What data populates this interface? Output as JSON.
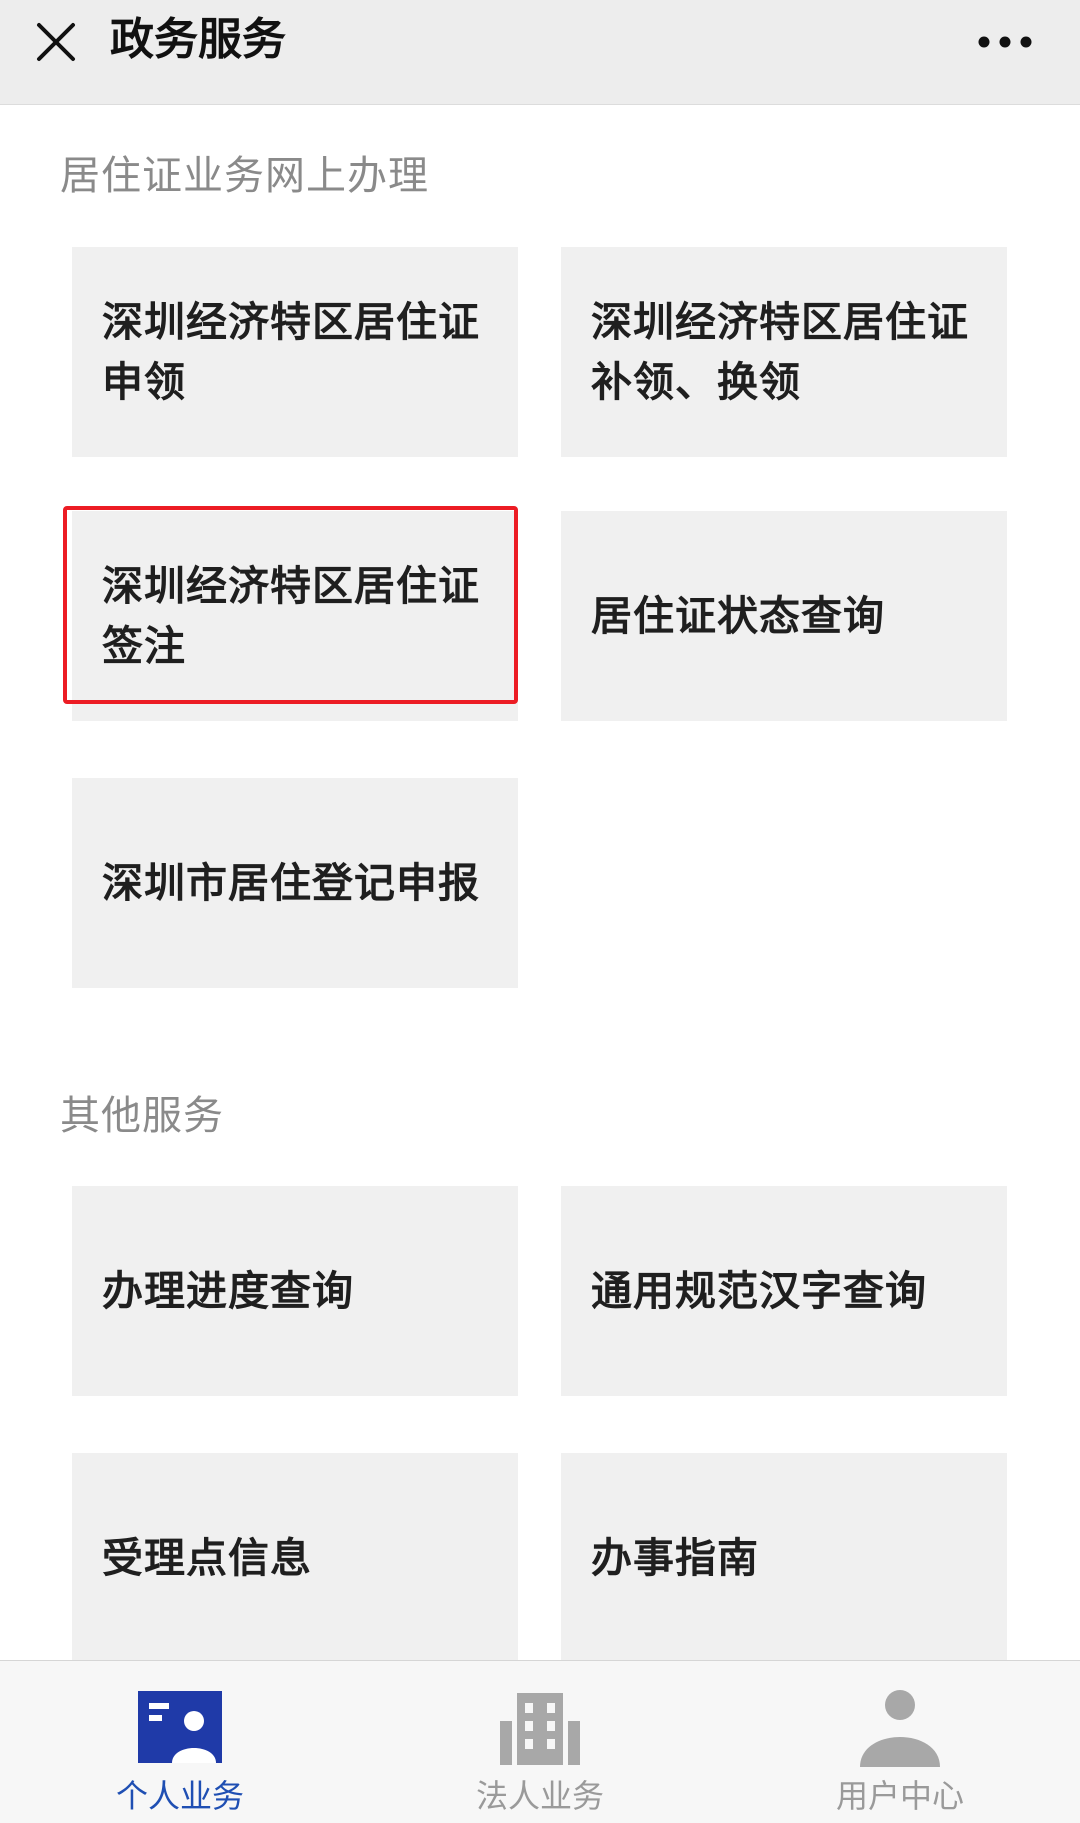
{
  "header": {
    "title": "政务服务",
    "close_icon": "close-icon",
    "more_icon": "more-dots-icon"
  },
  "sections": [
    {
      "title": "居住证业务网上办理",
      "items": [
        {
          "label": "深圳经济特区居住证申领"
        },
        {
          "label": "深圳经济特区居住证补领、换领"
        },
        {
          "label": "深圳经济特区居住证签注",
          "highlighted": true
        },
        {
          "label": "居住证状态查询"
        },
        {
          "label": "深圳市居住登记申报"
        }
      ]
    },
    {
      "title": "其他服务",
      "items": [
        {
          "label": "办理进度查询"
        },
        {
          "label": "通用规范汉字查询"
        },
        {
          "label": "受理点信息"
        },
        {
          "label": "办事指南"
        }
      ]
    }
  ],
  "highlight_color": "#ec1c24",
  "tabbar": {
    "active_index": 0,
    "active_color": "#1f4fb3",
    "inactive_color": "#9a9a9a",
    "tabs": [
      {
        "label": "个人业务",
        "icon": "person-card-icon"
      },
      {
        "label": "法人业务",
        "icon": "building-icon"
      },
      {
        "label": "用户中心",
        "icon": "user-icon"
      }
    ]
  }
}
